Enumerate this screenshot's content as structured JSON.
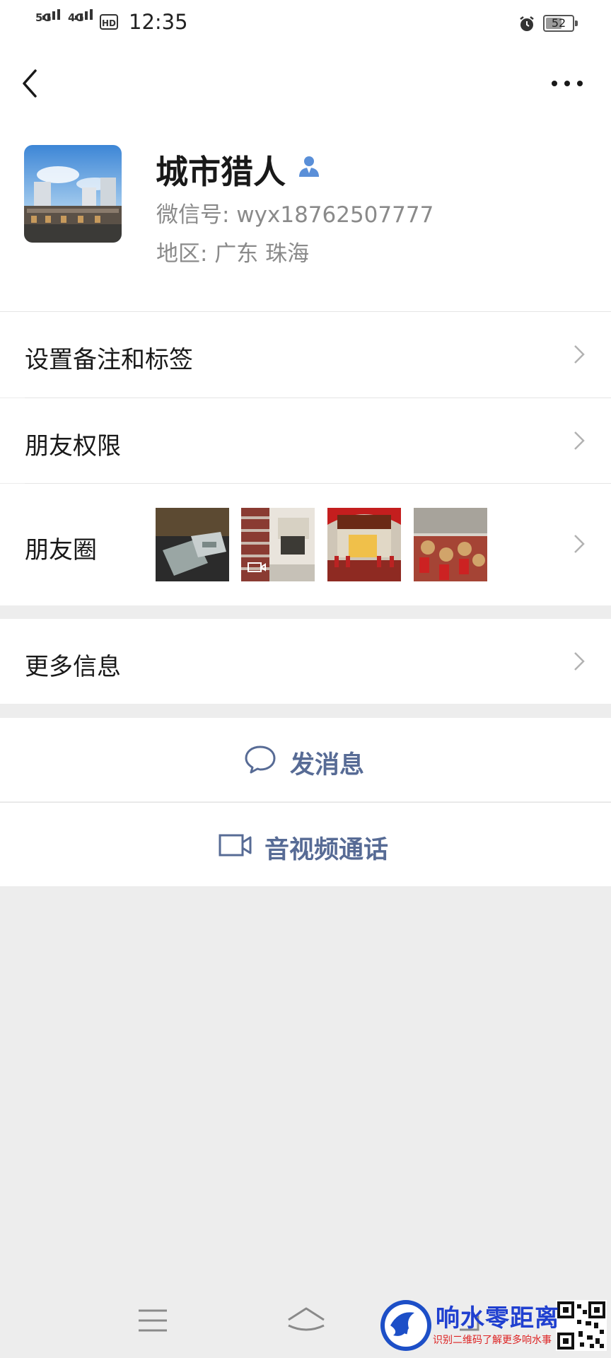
{
  "status_bar": {
    "sim1": "5G",
    "sim2": "4G",
    "hd": "HD",
    "time": "12:35",
    "battery": "52",
    "icons": [
      "signal-icon",
      "hd-icon",
      "alarm-icon",
      "battery-icon"
    ]
  },
  "header": {
    "icons": [
      "back-icon",
      "more-icon"
    ]
  },
  "profile": {
    "nickname": "城市猎人",
    "wechat_id": "微信号:  wyx18762507777",
    "region": "地区:  广东  珠海",
    "icons": [
      "avatar-image",
      "verified-person-icon"
    ]
  },
  "menu": {
    "remark_tags": "设置备注和标签",
    "friend_permissions": "朋友权限",
    "moments": "朋友圈",
    "more_info": "更多信息"
  },
  "moments_thumbs": [
    "thumb-photo-1",
    "thumb-video-2",
    "thumb-photo-3",
    "thumb-photo-4"
  ],
  "actions": {
    "send_message": "发消息",
    "video_call": "音视频通话",
    "icons": [
      "chat-bubble-icon",
      "video-camera-icon"
    ]
  },
  "nav_bar": {
    "icons": [
      "menu-icon",
      "home-icon",
      "back-nav-icon"
    ]
  },
  "watermark": {
    "title": "响水零距离",
    "subtitle": "识别二维码了解更多响水事"
  },
  "colors": {
    "link_blue": "#576b95",
    "background": "#ededed",
    "verified_blue": "#5a8fd8"
  }
}
